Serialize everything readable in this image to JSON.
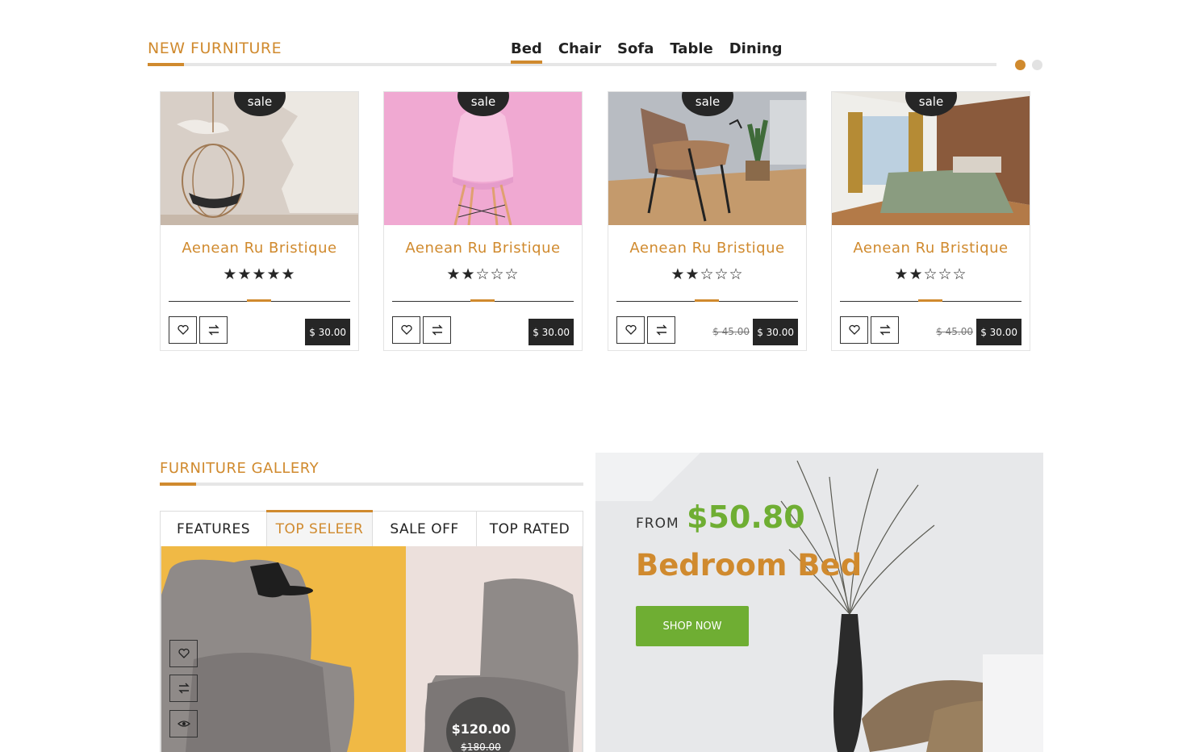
{
  "new_furniture": {
    "title": "NEW FURNITURE",
    "tabs": [
      "Bed",
      "Chair",
      "Sofa",
      "Table",
      "Dining"
    ],
    "active_tab": "Bed",
    "carousel_dots": 2,
    "products": [
      {
        "badge": "sale",
        "name": "Aenean Ru Bristique",
        "rating": 5,
        "stars": "★★★★★",
        "old_price": "",
        "price": "$ 30.00",
        "image": "hanging-chair"
      },
      {
        "badge": "sale",
        "name": "Aenean Ru Bristique",
        "rating": 2,
        "stars": "★★☆☆☆",
        "old_price": "",
        "price": "$ 30.00",
        "image": "pink-chair"
      },
      {
        "badge": "sale",
        "name": "Aenean Ru Bristique",
        "rating": 2,
        "stars": "★★☆☆☆",
        "old_price": "$ 45.00",
        "price": "$ 30.00",
        "image": "lounge-chair"
      },
      {
        "badge": "sale",
        "name": "Aenean Ru Bristique",
        "rating": 2,
        "stars": "★★☆☆☆",
        "old_price": "$ 45.00",
        "price": "$ 30.00",
        "image": "bedroom"
      }
    ]
  },
  "gallery": {
    "title": "FURNITURE GALLERY",
    "tabs": [
      "FEATURES",
      "TOP SELEER",
      "SALE OFF",
      "TOP RATED"
    ],
    "active_tab": "TOP SELEER",
    "price": "$120.00",
    "old_price": "$180.00"
  },
  "banner": {
    "from_label": "FROM",
    "price": "$50.80",
    "title": "Bedroom Bed",
    "button_label": "SHOP NOW"
  },
  "colors": {
    "accent": "#d08a2e",
    "green": "#6fae33",
    "dark": "#262626"
  }
}
